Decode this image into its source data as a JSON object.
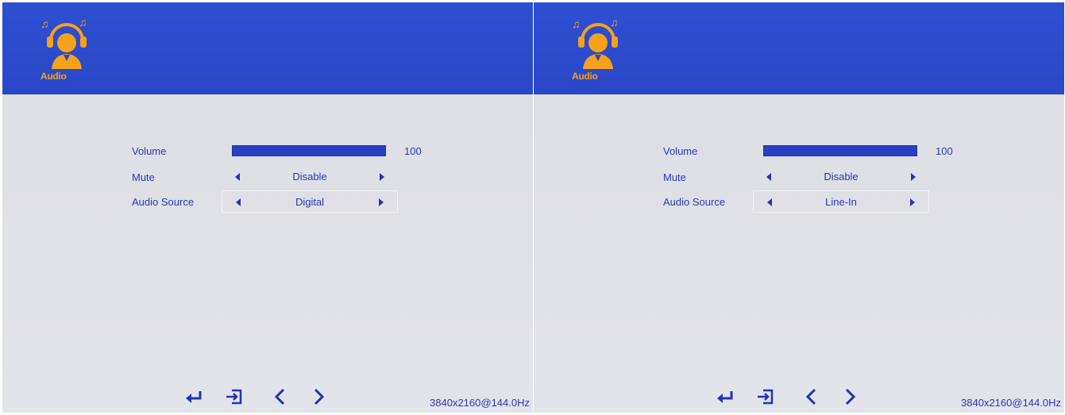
{
  "colors": {
    "accent": "#2a47c8",
    "text": "#2b36b8",
    "icon": "#f6a21a",
    "background": "#e0e2e8"
  },
  "screens": [
    {
      "header": {
        "icon": "audio-headphones-icon",
        "title": "Audio"
      },
      "menu": {
        "volume": {
          "label": "Volume",
          "value": "100",
          "level": 1.0
        },
        "mute": {
          "label": "Mute",
          "value": "Disable"
        },
        "audio_source": {
          "label": "Audio Source",
          "value": "Digital",
          "selected": true
        }
      },
      "footer": {
        "buttons": [
          "enter-icon",
          "exit-icon",
          "chevron-left-icon",
          "chevron-right-icon"
        ],
        "resolution": "3840x2160@144.0Hz"
      }
    },
    {
      "header": {
        "icon": "audio-headphones-icon",
        "title": "Audio"
      },
      "menu": {
        "volume": {
          "label": "Volume",
          "value": "100",
          "level": 1.0
        },
        "mute": {
          "label": "Mute",
          "value": "Disable"
        },
        "audio_source": {
          "label": "Audio Source",
          "value": "Line-In",
          "selected": true
        }
      },
      "footer": {
        "buttons": [
          "enter-icon",
          "exit-icon",
          "chevron-left-icon",
          "chevron-right-icon"
        ],
        "resolution": "3840x2160@144.0Hz"
      }
    }
  ]
}
